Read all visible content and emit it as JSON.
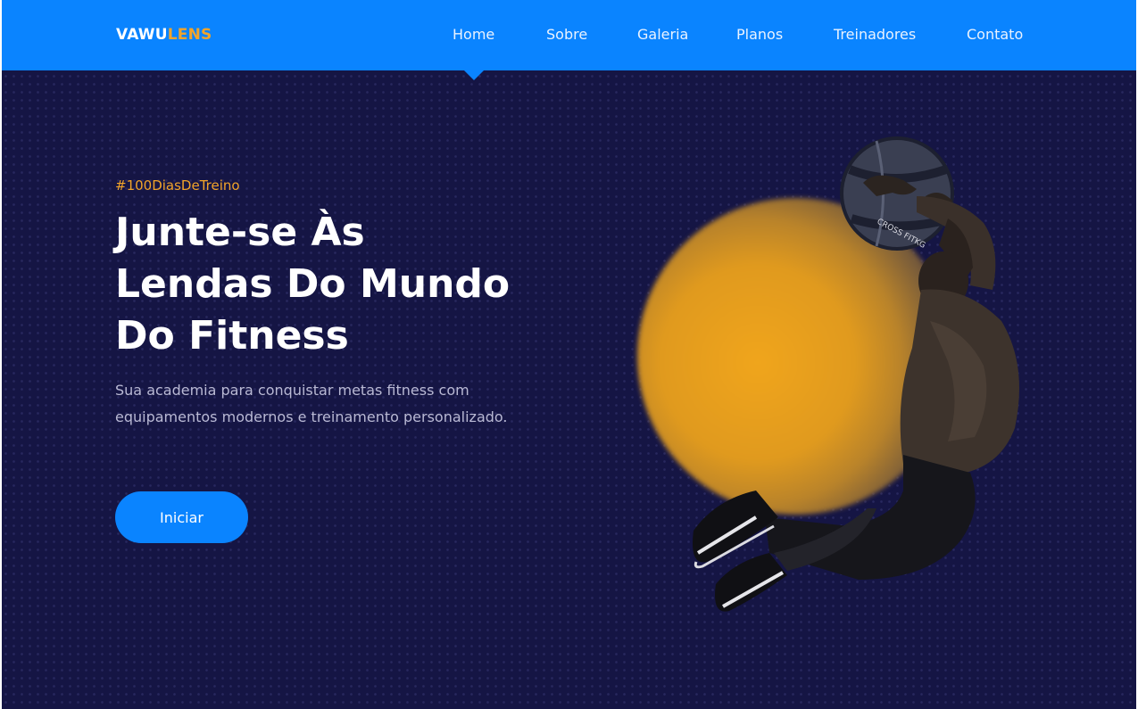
{
  "brand": {
    "logo_part1": "VAWU",
    "logo_part2": "LENS"
  },
  "nav": {
    "items": [
      {
        "label": "Home",
        "active": true
      },
      {
        "label": "Sobre"
      },
      {
        "label": "Galeria"
      },
      {
        "label": "Planos"
      },
      {
        "label": "Treinadores"
      },
      {
        "label": "Contato"
      }
    ]
  },
  "hero": {
    "hashtag": "#100DiasDeTreino",
    "headline_lines": [
      "Junte-se Às",
      "Lendas Do Mundo",
      "Do Fitness"
    ],
    "subtitle": "Sua academia para conquistar metas fitness com equipamentos modernos e treinamento personalizado.",
    "cta_label": "Iniciar",
    "ball_print": "CROSS FITKG"
  },
  "colors": {
    "accent": "#0a84ff",
    "brand_orange": "#f2a42a",
    "background": "#151544"
  },
  "icons": [
    "athlete-illustration",
    "medicine-ball-icon"
  ]
}
